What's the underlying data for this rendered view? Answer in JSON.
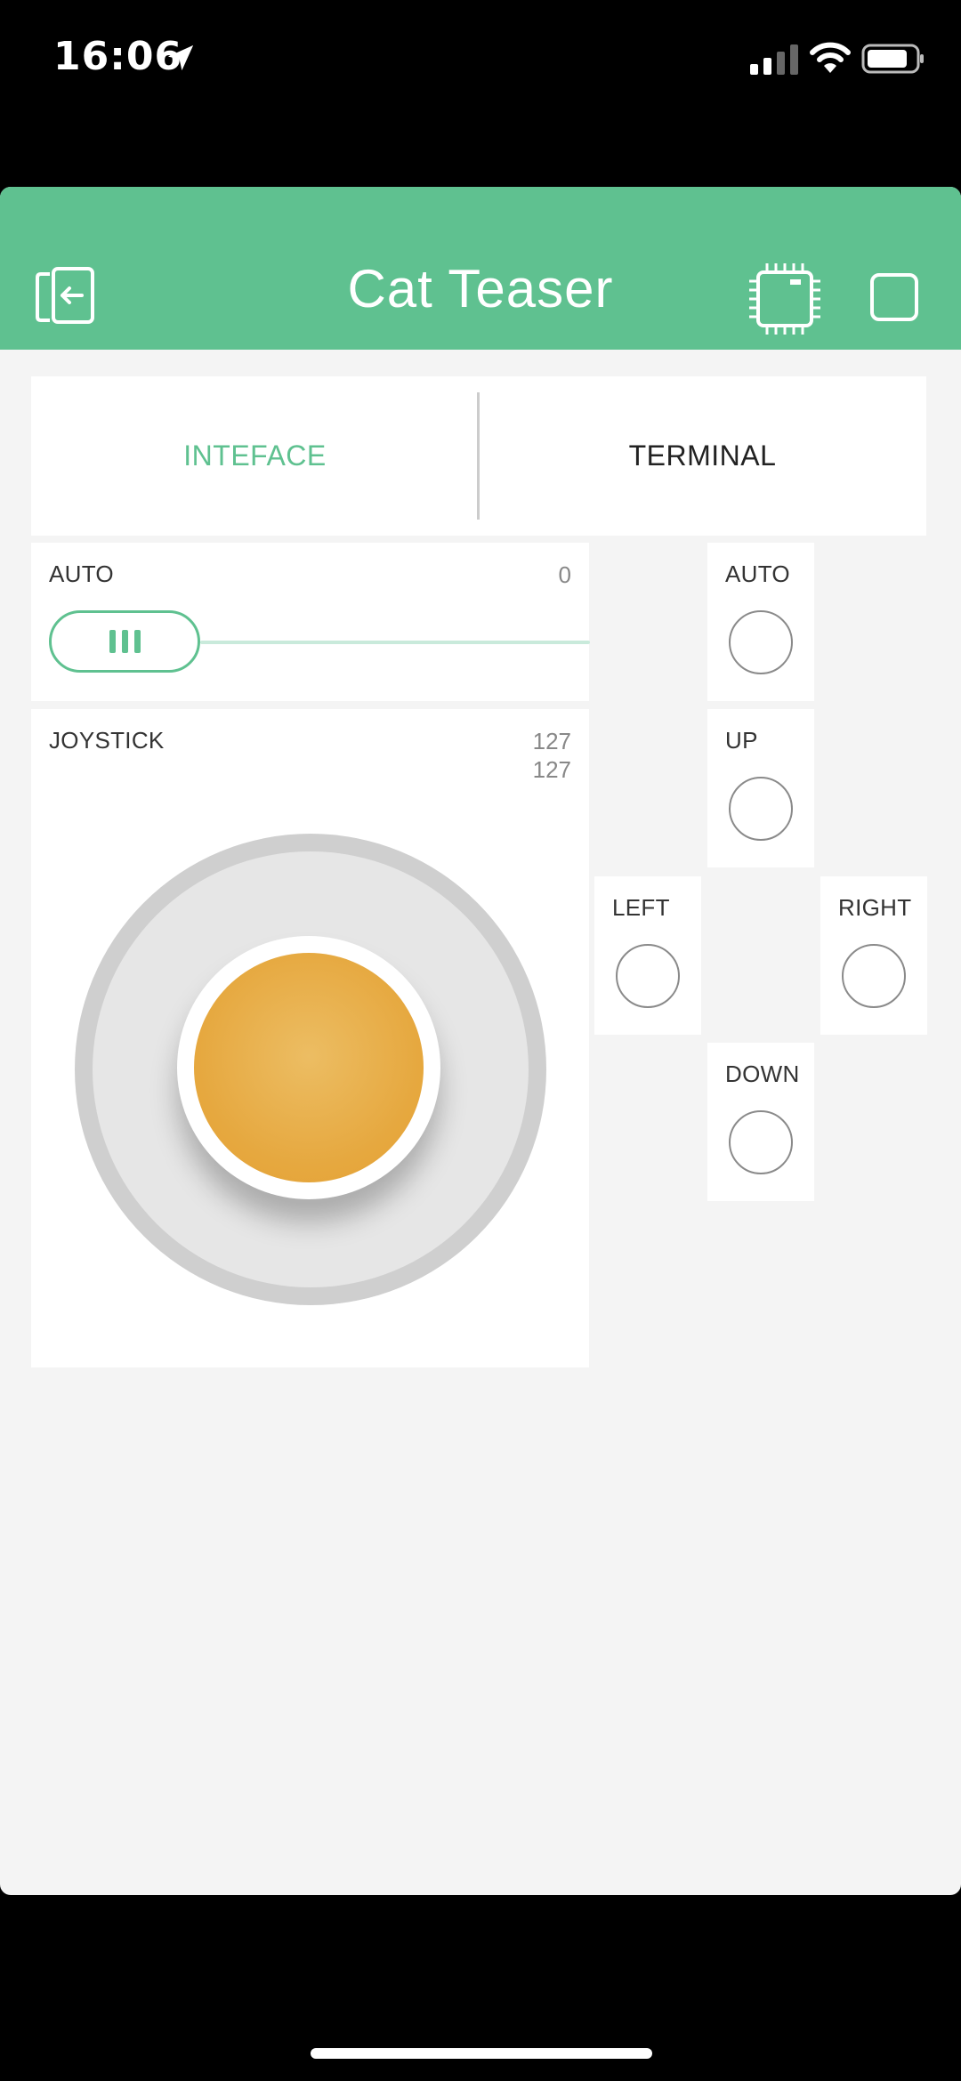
{
  "status_bar": {
    "time": "16:06",
    "icons": [
      "location-arrow-icon",
      "cellular-signal-icon",
      "wifi-icon",
      "battery-icon"
    ]
  },
  "header": {
    "title": "Cat Teaser",
    "background_color": "#5fc190",
    "left_icon": "exit-icon",
    "right_icons": [
      "device-chip-icon",
      "stop-square-icon"
    ]
  },
  "tabs": [
    {
      "label": "INTEFACE",
      "active": true
    },
    {
      "label": "TERMINAL",
      "active": false
    }
  ],
  "widgets": {
    "slider": {
      "label": "AUTO",
      "value": "0",
      "accent_color": "#5fc190"
    },
    "joystick": {
      "label": "JOYSTICK",
      "x_value": "127",
      "y_value": "127",
      "knob_color": "#e6a83f"
    },
    "buttons": {
      "auto": {
        "label": "AUTO"
      },
      "up": {
        "label": "UP"
      },
      "left": {
        "label": "LEFT"
      },
      "right": {
        "label": "RIGHT"
      },
      "down": {
        "label": "DOWN"
      }
    }
  },
  "colors": {
    "accent": "#5fc190",
    "canvas": "#f4f4f4",
    "joystick_knob": "#e6a83f"
  }
}
